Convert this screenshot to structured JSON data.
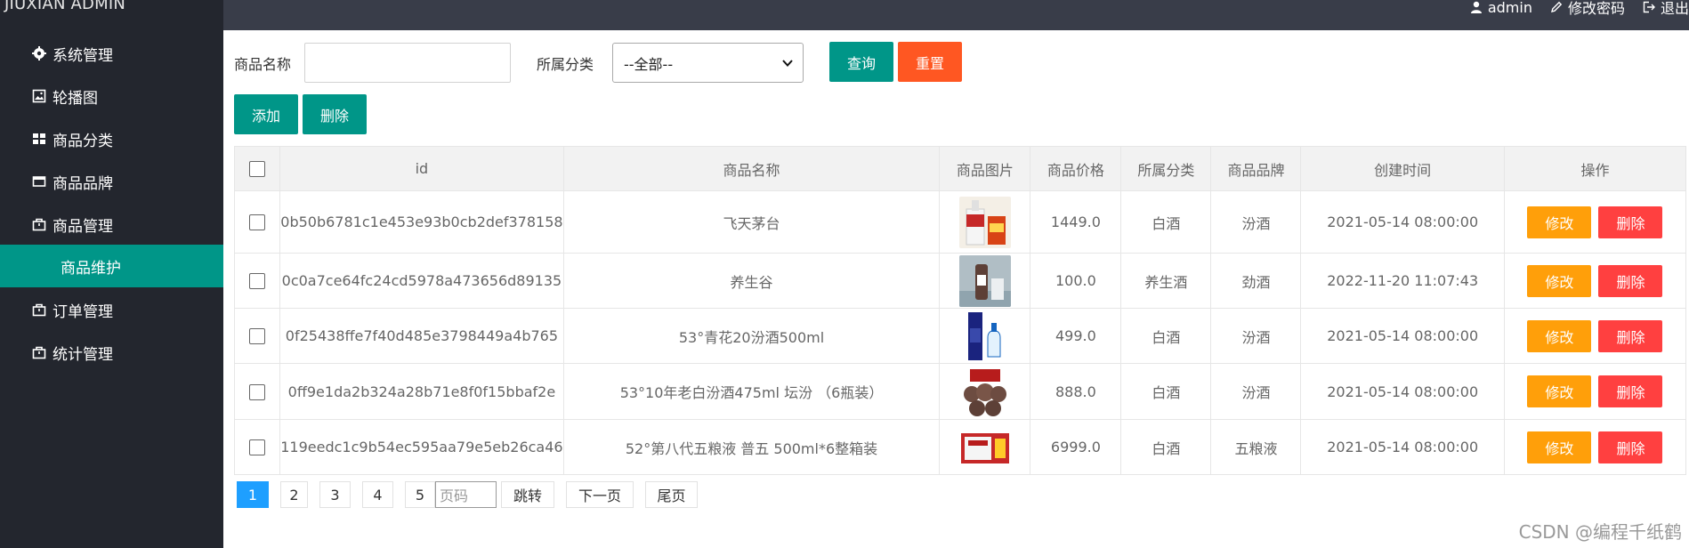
{
  "app": {
    "title": "JIUXIAN ADMIN"
  },
  "topbar": {
    "user": "admin",
    "change_password": "修改密码",
    "logout": "退出"
  },
  "sidebar": {
    "items": [
      {
        "label": "系统管理",
        "icon": "gear-icon"
      },
      {
        "label": "轮播图",
        "icon": "image-icon"
      },
      {
        "label": "商品分类",
        "icon": "grid-icon"
      },
      {
        "label": "商品品牌",
        "icon": "card-icon"
      },
      {
        "label": "商品管理",
        "icon": "bag-icon"
      },
      {
        "label": "商品维护",
        "icon": ""
      },
      {
        "label": "订单管理",
        "icon": "bag-icon"
      },
      {
        "label": "统计管理",
        "icon": "bag-icon"
      }
    ]
  },
  "search": {
    "name_label": "商品名称",
    "name_value": "",
    "category_label": "所属分类",
    "category_selected": "--全部--",
    "query_button": "查询",
    "reset_button": "重置"
  },
  "actions": {
    "add_button": "添加",
    "delete_button": "删除"
  },
  "table": {
    "headers": [
      "id",
      "商品名称",
      "商品图片",
      "商品价格",
      "所属分类",
      "商品品牌",
      "创建时间",
      "操作"
    ],
    "edit_label": "修改",
    "delete_label": "删除",
    "rows": [
      {
        "id": "0b50b6781c1e453e93b0cb2def378158",
        "name": "飞天茅台",
        "price": "1449.0",
        "category": "白酒",
        "brand": "汾酒",
        "created": "2021-05-14 08:00:00"
      },
      {
        "id": "0c0a7ce64fc24cd5978a473656d89135",
        "name": "养生谷",
        "price": "100.0",
        "category": "养生酒",
        "brand": "劲酒",
        "created": "2022-11-20 11:07:43"
      },
      {
        "id": "0f25438ffe7f40d485e3798449a4b765",
        "name": "53°青花20汾酒500ml",
        "price": "499.0",
        "category": "白酒",
        "brand": "汾酒",
        "created": "2021-05-14 08:00:00"
      },
      {
        "id": "0ff9e1da2b324a28b71e8f0f15bbaf2e",
        "name": "53°10年老白汾酒475ml 坛汾 （6瓶装）",
        "price": "888.0",
        "category": "白酒",
        "brand": "汾酒",
        "created": "2021-05-14 08:00:00"
      },
      {
        "id": "119eedc1c9b54ec595aa79e5eb26ca46",
        "name": "52°第八代五粮液 普五 500ml*6整箱装",
        "price": "6999.0",
        "category": "白酒",
        "brand": "五粮液",
        "created": "2021-05-14 08:00:00"
      }
    ]
  },
  "pager": {
    "pages": [
      "1",
      "2",
      "3",
      "4",
      "5"
    ],
    "current": "1",
    "page_input_placeholder": "页码",
    "jump": "跳转",
    "next": "下一页",
    "last": "尾页"
  },
  "watermark": "CSDN @编程千纸鹤",
  "colors": {
    "sidebar": "#23262e",
    "topbar": "#393d49",
    "primary": "#009688",
    "reset": "#ff5722",
    "edit": "#ff9f0a",
    "danger": "#ff4040",
    "page_current": "#1e9fff"
  }
}
